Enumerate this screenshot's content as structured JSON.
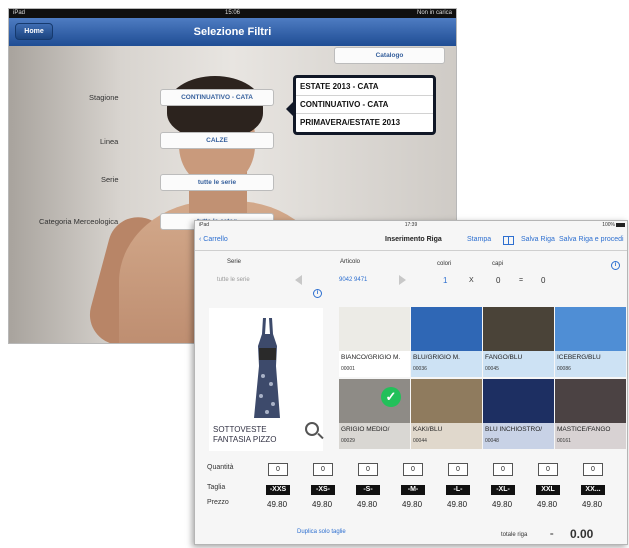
{
  "screen1": {
    "status": {
      "left": "iPad",
      "time": "15:06",
      "right": "Non in carica"
    },
    "nav": {
      "home_label": "Home",
      "title": "Selezione Filtri"
    },
    "catalog_button": "Catalogo",
    "filters": [
      {
        "label": "Stagione",
        "value": "CONTINUATIVO - CATA"
      },
      {
        "label": "Linea",
        "value": "CALZE"
      },
      {
        "label": "Serie",
        "value": "tutte le serie"
      },
      {
        "label": "Categoria Merceologica",
        "value": "tutte le categ"
      }
    ],
    "season_options": [
      "ESTATE 2013 - CATA",
      "CONTINUATIVO - CATA",
      "PRIMAVERA/ESTATE 2013"
    ]
  },
  "screen2": {
    "status": {
      "left": "iPad",
      "time": "17:39",
      "right": "100%"
    },
    "nav": {
      "back_label": "Carrello",
      "title": "Inserimento Riga",
      "stampa": "Stampa",
      "salva_riga": "Salva Riga",
      "salva_procedi": "Salva Riga e procedi"
    },
    "header": {
      "serie_label": "Serie",
      "serie_value": "tutte le serie",
      "articolo_label": "Articolo",
      "articolo_value": "9042 9471",
      "colori_label": "colori",
      "colori_value": "1",
      "times_sign": "X",
      "capi_label": "capi",
      "capi_value": "0",
      "equals_sign": "=",
      "total_value": "0"
    },
    "product": {
      "name_line1": "SOTTOVESTE",
      "name_line2": "FANTASIA PIZZO"
    },
    "swatches": [
      {
        "name": "BIANCO/GRIGIO M.",
        "code": "00001",
        "fabric": "#ecebe6",
        "label_bg": "#ffffff",
        "selected": false
      },
      {
        "name": "BLU/GRIGIO M.",
        "code": "00036",
        "fabric": "#2f67b5",
        "label_bg": "#cde2f4",
        "selected": false
      },
      {
        "name": "FANGO/BLU",
        "code": "00045",
        "fabric": "#4a4338",
        "label_bg": "#cde2f4",
        "selected": false
      },
      {
        "name": "ICEBERG/BLU",
        "code": "00086",
        "fabric": "#4f8ed5",
        "label_bg": "#cde2f4",
        "selected": false
      },
      {
        "name": "GRIGIO MEDIO/",
        "code": "00029",
        "fabric": "#8e8b86",
        "label_bg": "#d9d7d3",
        "selected": true
      },
      {
        "name": "KAKI/BLU",
        "code": "00044",
        "fabric": "#8f7b5e",
        "label_bg": "#e0d8cc",
        "selected": false
      },
      {
        "name": "BLU INCHIOSTRO/",
        "code": "00048",
        "fabric": "#1d2f62",
        "label_bg": "#c8d2e6",
        "selected": false
      },
      {
        "name": "MASTICE/FANGO",
        "code": "00161",
        "fabric": "#4b4243",
        "label_bg": "#d8d2d3",
        "selected": false
      }
    ],
    "grid_labels": {
      "quantita": "Quantità",
      "taglia": "Taglia",
      "prezzo": "Prezzo"
    },
    "quantities": [
      "0",
      "0",
      "0",
      "0",
      "0",
      "0",
      "0",
      "0"
    ],
    "sizes": [
      "-XXS",
      "-XS-",
      "-S-",
      "-M-",
      "-L-",
      "-XL-",
      "XXL",
      "XX..."
    ],
    "prices": [
      "49.80",
      "49.80",
      "49.80",
      "49.80",
      "49.80",
      "49.80",
      "49.80",
      "49.80"
    ],
    "footer": {
      "duplica": "Duplica solo taglie",
      "totale_label": "totale riga",
      "equals": "=",
      "totale_value": "0.00"
    }
  }
}
